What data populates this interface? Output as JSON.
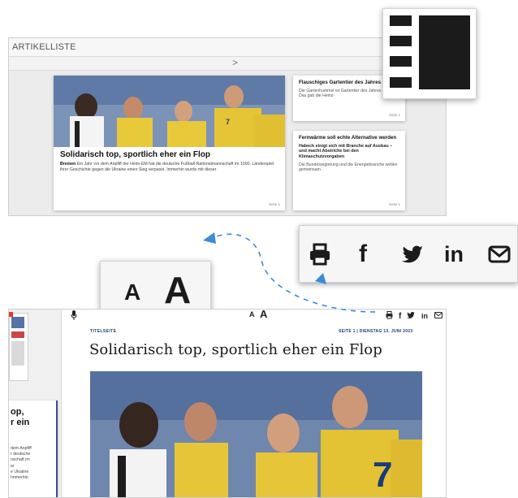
{
  "article_list": {
    "title": "ARTIKELLISTE",
    "nav_arrow": ">",
    "main_card": {
      "headline": "Solidarisch top, sportlich eher ein Flop",
      "lead_bold": "Bremen",
      "lead_text": " Ein Jahr vor dem Anpfiff der Heim-EM hat die deutsche Fußball-Nationalmannschaft im 1000. Länderspiel ihrer Geschichte gegen die Ukraine einen Sieg verpasst. Immerhin wurde mit dieser",
      "page": "Seite 1"
    },
    "side_card_1": {
      "headline": "Flauschiges Gartentier des Jahres",
      "text": "Die Gartenhummel ist Gartentier des Jahres 2023. Das gab die Heinz-",
      "page": "Seite 1"
    },
    "side_card_2": {
      "headline": "Fernwärme soll echte Alternative werden",
      "subheadline": "Habeck einigt sich mit Branche auf Ausbau – und macht Abstriche bei den Klimaschutzvorgaben",
      "text": "Die Bundesregierung und die Energiebranche wollen gemeinsam",
      "page": "Seite 1"
    }
  },
  "font_popup": {
    "small_label": "A",
    "large_label": "A"
  },
  "share_popup": {
    "icons": [
      "print-icon",
      "facebook-icon",
      "twitter-icon",
      "linkedin-icon",
      "mail-icon"
    ],
    "facebook_label": "f",
    "linkedin_label": "in"
  },
  "layout_popup": {
    "icon": "list-layout-icon"
  },
  "article_view": {
    "section": "TITELSEITE",
    "page_date": "SEITE 1  |  DIENSTAG 13. JUNI 2023",
    "headline": "Solidarisch top, sportlich eher ein Flop",
    "font_small": "A",
    "font_large": "A",
    "toolbar_fb": "f",
    "toolbar_in": "in",
    "overlay_title_1": "op,",
    "overlay_title_2": "r ein",
    "overlay_text": [
      " dem Anpfiff",
      "r deutsche",
      "nschaft im",
      "er",
      "e Ukraine",
      " Immerhin"
    ]
  },
  "colors": {
    "meta_blue": "#1b3a75",
    "arrow_blue": "#3a8bd8",
    "icon_dark": "#1b1b1b"
  }
}
